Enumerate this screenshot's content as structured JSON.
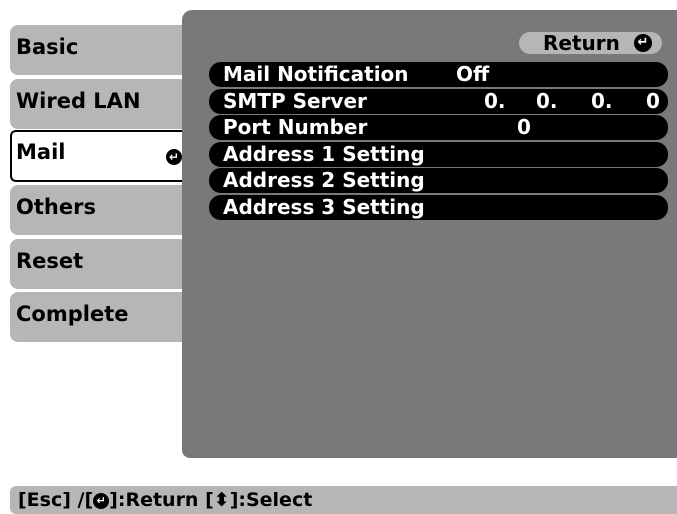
{
  "tabs": [
    {
      "label": "Basic"
    },
    {
      "label": "Wired LAN"
    },
    {
      "label": "Mail"
    },
    {
      "label": "Others"
    },
    {
      "label": "Reset"
    },
    {
      "label": "Complete"
    }
  ],
  "return_label": "Return",
  "rows": [
    {
      "label": "Mail Notification",
      "value": "Off"
    },
    {
      "label": "SMTP Server",
      "ip": [
        "0.",
        "0.",
        "0.",
        "0"
      ]
    },
    {
      "label": "Port Number",
      "value": "0"
    },
    {
      "label": "Address 1 Setting"
    },
    {
      "label": "Address 2 Setting"
    },
    {
      "label": "Address 3 Setting"
    }
  ],
  "status": {
    "prefix": "[Esc] /[",
    "return_text": "]:Return  [",
    "select_text": "]:Select"
  }
}
